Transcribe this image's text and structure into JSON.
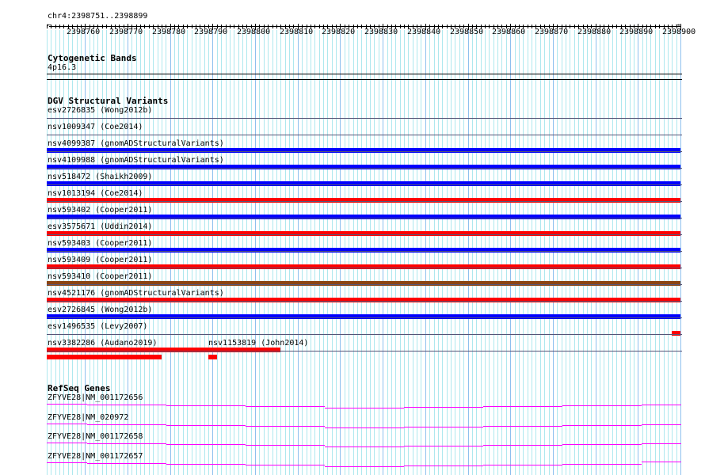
{
  "ruler": {
    "location": "chr4:2398751..2398899",
    "start": 2398751,
    "end": 2398899,
    "labels": [
      "2398760",
      "2398770",
      "2398780",
      "2398790",
      "2398800",
      "2398810",
      "2398820",
      "2398830",
      "2398840",
      "2398850",
      "2398860",
      "2398870",
      "2398880",
      "2398890",
      "2398900"
    ]
  },
  "cyto": {
    "title": "Cytogenetic Bands",
    "band": "4p16.3"
  },
  "dgv": {
    "title": "DGV Structural Variants",
    "colors": {
      "blue": "#0000ff",
      "red": "#ff0000",
      "brown": "#8b4513"
    },
    "rows": [
      [
        {
          "label": "esv2726835 (Wong2012b)",
          "color": null,
          "start": 2398751,
          "end": 2398899
        }
      ],
      [
        {
          "label": "nsv1009347 (Coe2014)",
          "color": "blue",
          "start": 2398751,
          "end": 2398899
        }
      ],
      [
        {
          "label": "nsv4099387 (gnomADStructuralVariants)",
          "color": "blue",
          "start": 2398751,
          "end": 2398899
        }
      ],
      [
        {
          "label": "nsv4109988 (gnomADStructuralVariants)",
          "color": "blue",
          "start": 2398751,
          "end": 2398899
        }
      ],
      [
        {
          "label": "nsv518472 (Shaikh2009)",
          "color": "red",
          "start": 2398751,
          "end": 2398899
        }
      ],
      [
        {
          "label": "nsv1013194 (Coe2014)",
          "color": "blue",
          "start": 2398751,
          "end": 2398899
        }
      ],
      [
        {
          "label": "nsv593402 (Cooper2011)",
          "color": "red",
          "start": 2398751,
          "end": 2398899
        }
      ],
      [
        {
          "label": "esv3575671 (Uddin2014)",
          "color": "blue",
          "start": 2398751,
          "end": 2398899
        }
      ],
      [
        {
          "label": "nsv593403 (Cooper2011)",
          "color": "red",
          "start": 2398751,
          "end": 2398899
        }
      ],
      [
        {
          "label": "nsv593409 (Cooper2011)",
          "color": "brown",
          "start": 2398751,
          "end": 2398899
        }
      ],
      [
        {
          "label": "nsv593410 (Cooper2011)",
          "color": "red",
          "start": 2398751,
          "end": 2398899
        }
      ],
      [
        {
          "label": "nsv4521176 (gnomADStructuralVariants)",
          "color": "blue",
          "start": 2398751,
          "end": 2398899
        }
      ],
      [
        {
          "label": "esv2726845 (Wong2012b)",
          "color": "red",
          "start": 2398898,
          "end": 2398899
        }
      ],
      [
        {
          "label": "esv1496535 (Levy2007)",
          "color": "red",
          "start": 2398751,
          "end": 2398805
        }
      ],
      [
        {
          "label": "nsv3382286 (Audano2019)",
          "color": "red",
          "start": 2398751,
          "end": 2398777
        },
        {
          "label": "nsv1153819 (John2014)",
          "color": "red",
          "start": 2398789,
          "end": 2398790
        }
      ]
    ]
  },
  "genes": {
    "title": "RefSeq Genes",
    "color": "#ff00ff",
    "items": [
      "ZFYVE28|NM_001172656",
      "ZFYVE28|NM_020972",
      "ZFYVE28|NM_001172658",
      "ZFYVE28|NM_001172657"
    ]
  }
}
